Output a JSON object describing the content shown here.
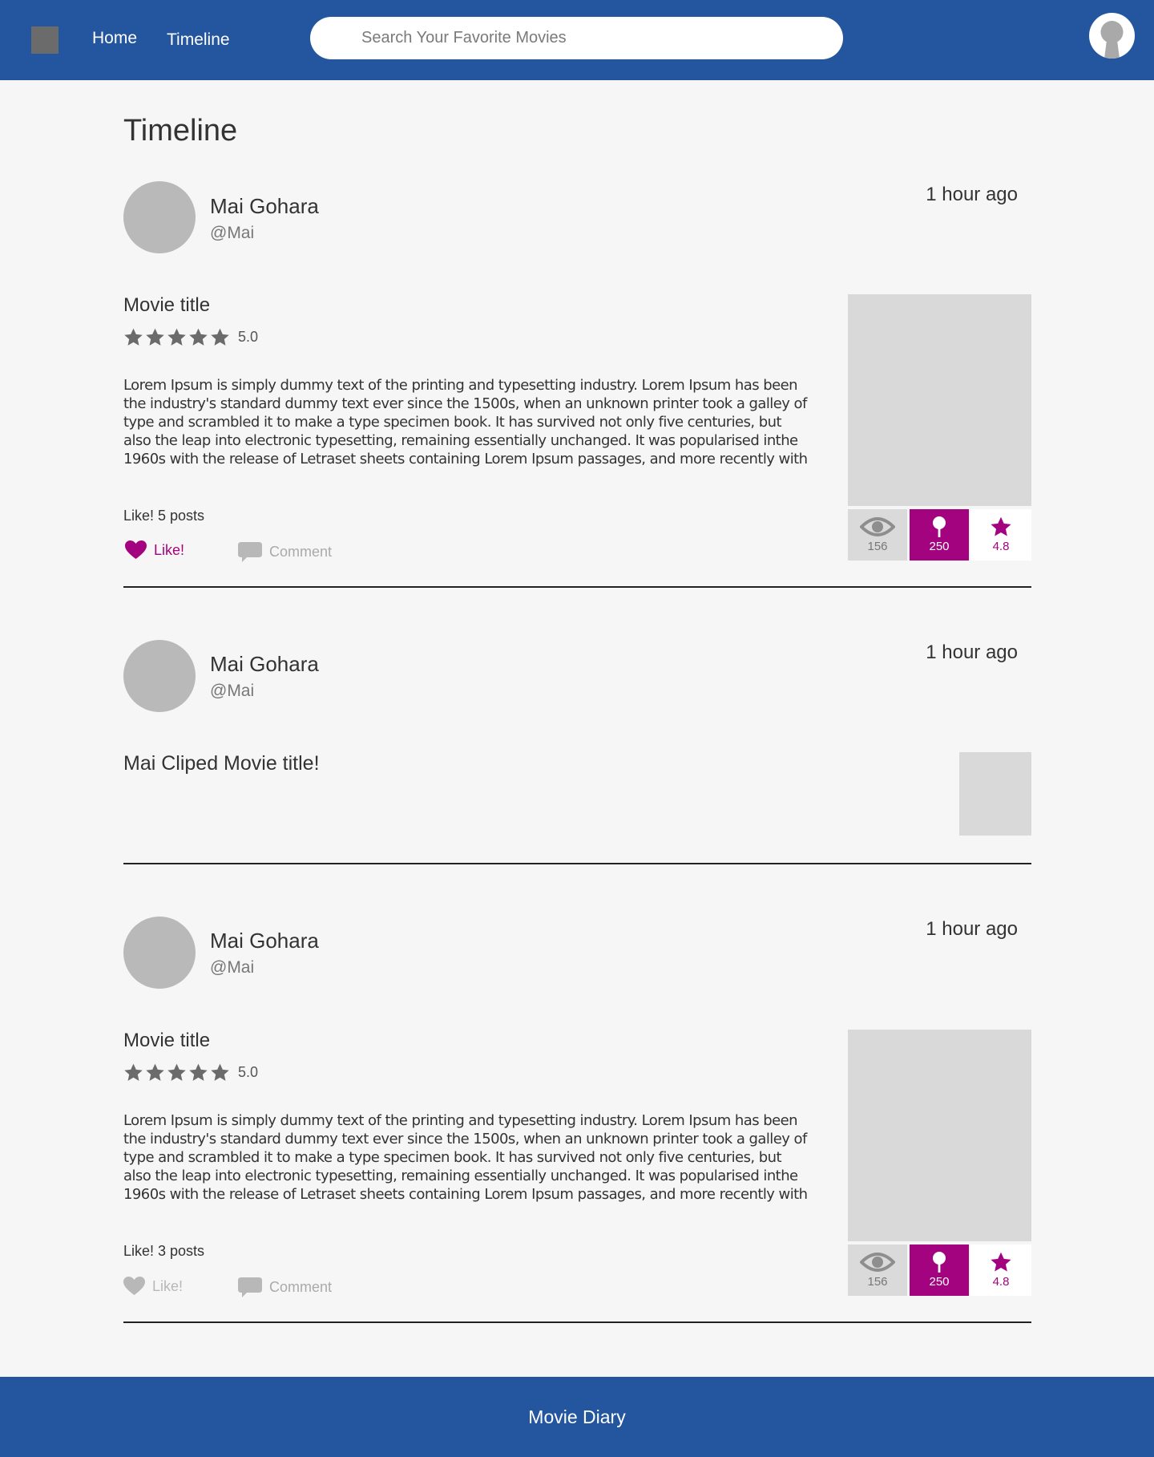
{
  "nav": {
    "home_label": "Home",
    "timeline_label": "Timeline",
    "search_placeholder": "Search Your Favorite Movies"
  },
  "page": {
    "title": "Timeline"
  },
  "colors": {
    "brand": "#23569f",
    "accent": "#a3037f",
    "like_active": "#a3037f",
    "inactive": "#b8b8b8"
  },
  "posts": [
    {
      "author": "Mai Gohara",
      "handle": "@Mai",
      "time": "1 hour ago",
      "movie_title": "Movie title",
      "rating": "5.0",
      "stars": 5,
      "description": "Lorem Ipsum is simply dummy text of the printing and typesetting industry. Lorem Ipsum has been the industry's standard dummy text ever since the 1500s, when an unknown printer took a galley of type and scrambled it to make a type specimen book. It has survived not only five centuries, but also the leap into electronic typesetting, remaining essentially unchanged. It was popularised inthe 1960s with the release of Letraset sheets containing Lorem Ipsum passages, and more recently with",
      "likes": "Like! 5 posts",
      "like_label": "Like!",
      "liked": true,
      "comment_label": "Comment",
      "stats": {
        "views": "156",
        "clips": "250",
        "rating": "4.8"
      }
    },
    {
      "author": "Mai Gohara",
      "handle": "@Mai",
      "time": "1 hour ago",
      "clip_text": "Mai Cliped Movie title!"
    },
    {
      "author": "Mai Gohara",
      "handle": "@Mai",
      "time": "1 hour ago",
      "movie_title": "Movie title",
      "rating": "5.0",
      "stars": 5,
      "description": "Lorem Ipsum is simply dummy text of the printing and typesetting industry. Lorem Ipsum has been the industry's standard dummy text ever since the 1500s, when an unknown printer took a galley of type and scrambled it to make a type specimen book. It has survived not only five centuries, but also the leap into electronic typesetting, remaining essentially unchanged. It was popularised inthe 1960s with the release of Letraset sheets containing Lorem Ipsum passages, and more recently with",
      "likes": "Like! 3 posts",
      "like_label": "Like!",
      "liked": false,
      "comment_label": "Comment",
      "stats": {
        "views": "156",
        "clips": "250",
        "rating": "4.8"
      }
    }
  ],
  "footer": {
    "title": "Movie Diary"
  }
}
